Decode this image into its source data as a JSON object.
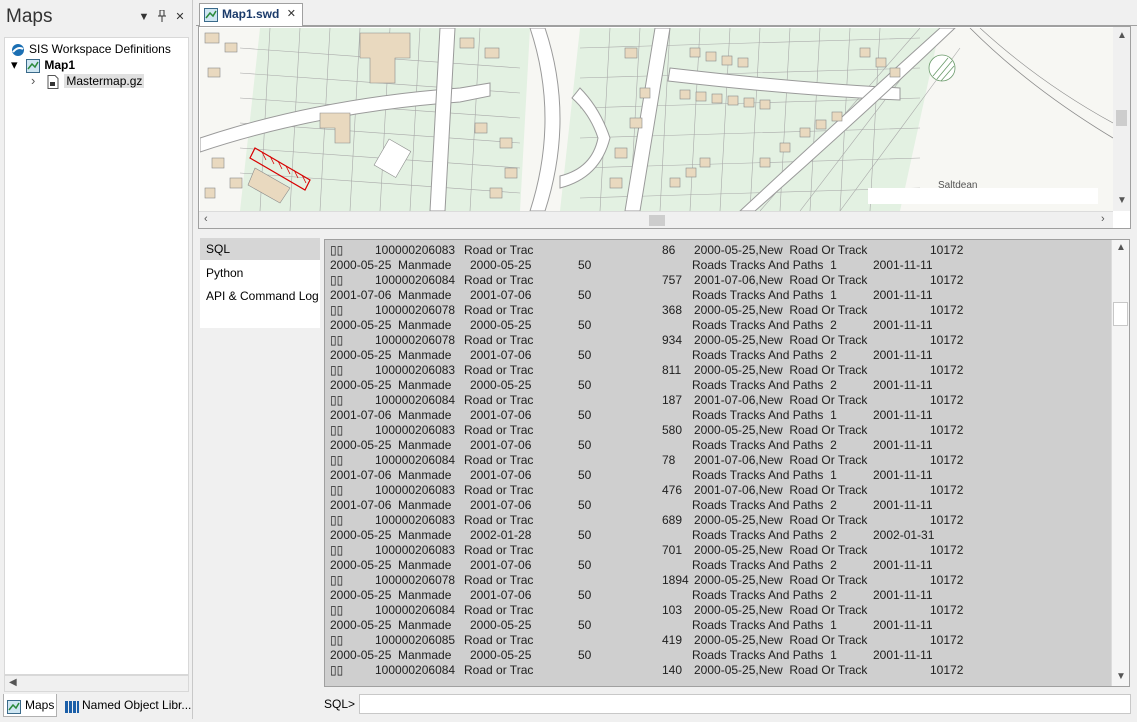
{
  "left_panel": {
    "title": "Maps",
    "buttons": {
      "dropdown": "▼",
      "pin": "📌",
      "close": "✕"
    },
    "tree": [
      {
        "label": "SIS Workspace Definitions",
        "icon": "workspace-icon"
      },
      {
        "label": "Map1",
        "icon": "map-icon",
        "expander": "▾"
      },
      {
        "label": "Mastermap.gz",
        "icon": "dataset-icon",
        "expander": "›"
      }
    ],
    "tabs": [
      {
        "label": "Maps",
        "icon": "map-icon"
      },
      {
        "label": "Named Object Libr...",
        "icon": "library-icon"
      }
    ]
  },
  "document": {
    "tab_label": "Map1.swd",
    "tab_close": "✕",
    "map_label": "Saltdean"
  },
  "console": {
    "side_items": [
      "SQL",
      "Python",
      "API & Command Log"
    ],
    "selected_side_item": "SQL",
    "rows": [
      {
        "a": "▯▯",
        "b": "100000206083",
        "c": "Road or Trac",
        "d": "86",
        "e": "2000-05-25,New  Road Or Track",
        "f": "10172"
      },
      {
        "a": "2000-05-25",
        "b": "Manmade",
        "c": "2000-05-25",
        "d": "50",
        "e": "Roads Tracks And Paths  1",
        "f": "2001-11-11"
      },
      {
        "a": "▯▯",
        "b": "100000206084",
        "c": "Road or Trac",
        "d": "757",
        "e": "2001-07-06,New  Road Or Track",
        "f": "10172"
      },
      {
        "a": "2001-07-06",
        "b": "Manmade",
        "c": "2001-07-06",
        "d": "50",
        "e": "Roads Tracks And Paths  1",
        "f": "2001-11-11"
      },
      {
        "a": "▯▯",
        "b": "100000206078",
        "c": "Road or Trac",
        "d": "368",
        "e": "2000-05-25,New  Road Or Track",
        "f": "10172"
      },
      {
        "a": "2000-05-25",
        "b": "Manmade",
        "c": "2000-05-25",
        "d": "50",
        "e": "Roads Tracks And Paths  2",
        "f": "2001-11-11"
      },
      {
        "a": "▯▯",
        "b": "100000206078",
        "c": "Road or Trac",
        "d": "934",
        "e": "2000-05-25,New  Road Or Track",
        "f": "10172"
      },
      {
        "a": "2000-05-25",
        "b": "Manmade",
        "c": "2001-07-06",
        "d": "50",
        "e": "Roads Tracks And Paths  2",
        "f": "2001-11-11"
      },
      {
        "a": "▯▯",
        "b": "100000206083",
        "c": "Road or Trac",
        "d": "811",
        "e": "2000-05-25,New  Road Or Track",
        "f": "10172"
      },
      {
        "a": "2000-05-25",
        "b": "Manmade",
        "c": "2000-05-25",
        "d": "50",
        "e": "Roads Tracks And Paths  2",
        "f": "2001-11-11"
      },
      {
        "a": "▯▯",
        "b": "100000206084",
        "c": "Road or Trac",
        "d": "187",
        "e": "2001-07-06,New  Road Or Track",
        "f": "10172"
      },
      {
        "a": "2001-07-06",
        "b": "Manmade",
        "c": "2001-07-06",
        "d": "50",
        "e": "Roads Tracks And Paths  1",
        "f": "2001-11-11"
      },
      {
        "a": "▯▯",
        "b": "100000206083",
        "c": "Road or Trac",
        "d": "580",
        "e": "2000-05-25,New  Road Or Track",
        "f": "10172"
      },
      {
        "a": "2000-05-25",
        "b": "Manmade",
        "c": "2001-07-06",
        "d": "50",
        "e": "Roads Tracks And Paths  2",
        "f": "2001-11-11"
      },
      {
        "a": "▯▯",
        "b": "100000206084",
        "c": "Road or Trac",
        "d": "78",
        "e": "2001-07-06,New  Road Or Track",
        "f": "10172"
      },
      {
        "a": "2001-07-06",
        "b": "Manmade",
        "c": "2001-07-06",
        "d": "50",
        "e": "Roads Tracks And Paths  1",
        "f": "2001-11-11"
      },
      {
        "a": "▯▯",
        "b": "100000206083",
        "c": "Road or Trac",
        "d": "476",
        "e": "2001-07-06,New  Road Or Track",
        "f": "10172"
      },
      {
        "a": "2001-07-06",
        "b": "Manmade",
        "c": "2001-07-06",
        "d": "50",
        "e": "Roads Tracks And Paths  2",
        "f": "2001-11-11"
      },
      {
        "a": "▯▯",
        "b": "100000206083",
        "c": "Road or Trac",
        "d": "689",
        "e": "2000-05-25,New  Road Or Track",
        "f": "10172"
      },
      {
        "a": "2000-05-25",
        "b": "Manmade",
        "c": "2002-01-28",
        "d": "50",
        "e": "Roads Tracks And Paths  2",
        "f": "2002-01-31"
      },
      {
        "a": "▯▯",
        "b": "100000206083",
        "c": "Road or Trac",
        "d": "701",
        "e": "2000-05-25,New  Road Or Track",
        "f": "10172"
      },
      {
        "a": "2000-05-25",
        "b": "Manmade",
        "c": "2001-07-06",
        "d": "50",
        "e": "Roads Tracks And Paths  2",
        "f": "2001-11-11"
      },
      {
        "a": "▯▯",
        "b": "100000206078",
        "c": "Road or Trac",
        "d": "1894",
        "e": "2000-05-25,New  Road Or Track",
        "f": "10172"
      },
      {
        "a": "2000-05-25",
        "b": "Manmade",
        "c": "2001-07-06",
        "d": "50",
        "e": "Roads Tracks And Paths  2",
        "f": "2001-11-11"
      },
      {
        "a": "▯▯",
        "b": "100000206084",
        "c": "Road or Trac",
        "d": "103",
        "e": "2000-05-25,New  Road Or Track",
        "f": "10172"
      },
      {
        "a": "2000-05-25",
        "b": "Manmade",
        "c": "2000-05-25",
        "d": "50",
        "e": "Roads Tracks And Paths  1",
        "f": "2001-11-11"
      },
      {
        "a": "▯▯",
        "b": "100000206085",
        "c": "Road or Trac",
        "d": "419",
        "e": "2000-05-25,New  Road Or Track",
        "f": "10172"
      },
      {
        "a": "2000-05-25",
        "b": "Manmade",
        "c": "2000-05-25",
        "d": "50",
        "e": "Roads Tracks And Paths  1",
        "f": "2001-11-11"
      },
      {
        "a": "▯▯",
        "b": "100000206084",
        "c": "Road or Trac",
        "d": "140",
        "e": "2000-05-25,New  Road Or Track",
        "f": "10172"
      }
    ],
    "prompt": "SQL>",
    "input_value": ""
  },
  "colors": {
    "map_background": "#f7f7f3",
    "map_building": "#e9d9bf",
    "map_green": "#e3f1e2",
    "map_road": "#ffffff",
    "map_outline": "#8a8a8a",
    "highlight": "#d80000",
    "console_bg": "#cfcfcf",
    "selection": "#d6d6d6"
  }
}
